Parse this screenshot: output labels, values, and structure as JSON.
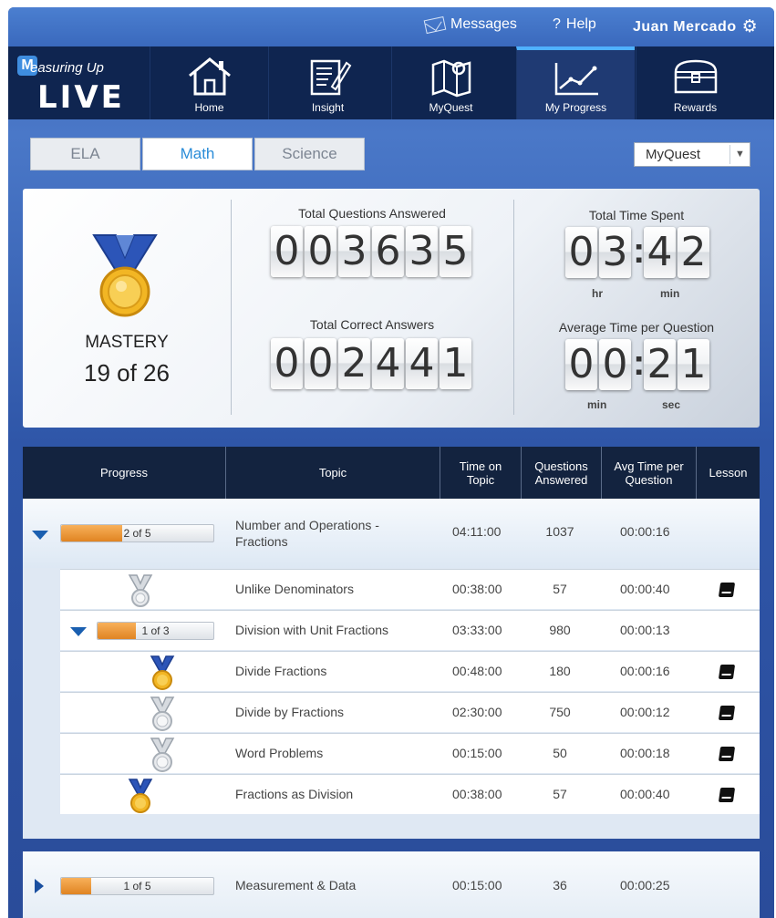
{
  "topbar": {
    "messages_label": "Messages",
    "help_label": "Help",
    "help_icon": "?",
    "user_name": "Juan Mercado",
    "settings_icon": "gear-icon"
  },
  "logo": {
    "text_top": "easuring Up",
    "text_m": "M",
    "text_live": "LIVE"
  },
  "nav": {
    "items": [
      {
        "label": "Home",
        "icon": "house-icon"
      },
      {
        "label": "Insight",
        "icon": "notepad-pencil-icon"
      },
      {
        "label": "MyQuest",
        "icon": "map-pin-icon"
      },
      {
        "label": "My Progress",
        "icon": "line-chart-icon",
        "active": true
      },
      {
        "label": "Rewards",
        "icon": "treasure-chest-icon"
      }
    ]
  },
  "subjects": {
    "tabs": [
      {
        "label": "ELA"
      },
      {
        "label": "Math",
        "active": true
      },
      {
        "label": "Science"
      }
    ],
    "dropdown_value": "MyQuest"
  },
  "stats": {
    "mastery_label": "MASTERY",
    "mastery_value": "19 of 26",
    "total_questions_label": "Total Questions Answered",
    "total_questions_digits": [
      "0",
      "0",
      "3",
      "6",
      "3",
      "5"
    ],
    "total_correct_label": "Total Correct Answers",
    "total_correct_digits": [
      "0",
      "0",
      "2",
      "4",
      "4",
      "1"
    ],
    "total_time_label": "Total Time Spent",
    "total_time_digits": [
      "0",
      "3",
      "4",
      "2"
    ],
    "total_time_units": [
      "hr",
      "min"
    ],
    "avg_time_label": "Average Time per Question",
    "avg_time_digits": [
      "0",
      "0",
      "2",
      "1"
    ],
    "avg_time_units": [
      "min",
      "sec"
    ]
  },
  "table": {
    "headers": [
      "Progress",
      "Topic",
      "Time on Topic",
      "Questions Answered",
      "Avg Time per Question",
      "Lesson"
    ],
    "groups": [
      {
        "progress": "2 of 5",
        "progress_fraction": 0.4,
        "topic": "Number and Operations - Fractions",
        "time": "04:11:00",
        "questions": "1037",
        "avg": "00:00:16",
        "expanded": true,
        "rows": [
          {
            "medal": "silver",
            "topic": "Unlike Denominators",
            "time": "00:38:00",
            "questions": "57",
            "avg": "00:00:40",
            "lesson": true
          },
          {
            "subgroup": true,
            "progress": "1 of 3",
            "progress_fraction": 0.33,
            "topic": "Division with Unit Fractions",
            "time": "03:33:00",
            "questions": "980",
            "avg": "00:00:13",
            "lesson": false
          },
          {
            "medal": "gold",
            "topic": "Divide Fractions",
            "time": "00:48:00",
            "questions": "180",
            "avg": "00:00:16",
            "lesson": true
          },
          {
            "medal": "silver",
            "topic": "Divide by Fractions",
            "time": "02:30:00",
            "questions": "750",
            "avg": "00:00:12",
            "lesson": true
          },
          {
            "medal": "silver",
            "topic": "Word Problems",
            "time": "00:15:00",
            "questions": "50",
            "avg": "00:00:18",
            "lesson": true
          },
          {
            "medal": "gold",
            "topic": "Fractions as Division",
            "time": "00:38:00",
            "questions": "57",
            "avg": "00:00:40",
            "lesson": true
          }
        ]
      },
      {
        "progress": "1 of 5",
        "progress_fraction": 0.2,
        "topic": "Measurement & Data",
        "time": "00:15:00",
        "questions": "36",
        "avg": "00:00:25",
        "expanded": false
      }
    ]
  }
}
